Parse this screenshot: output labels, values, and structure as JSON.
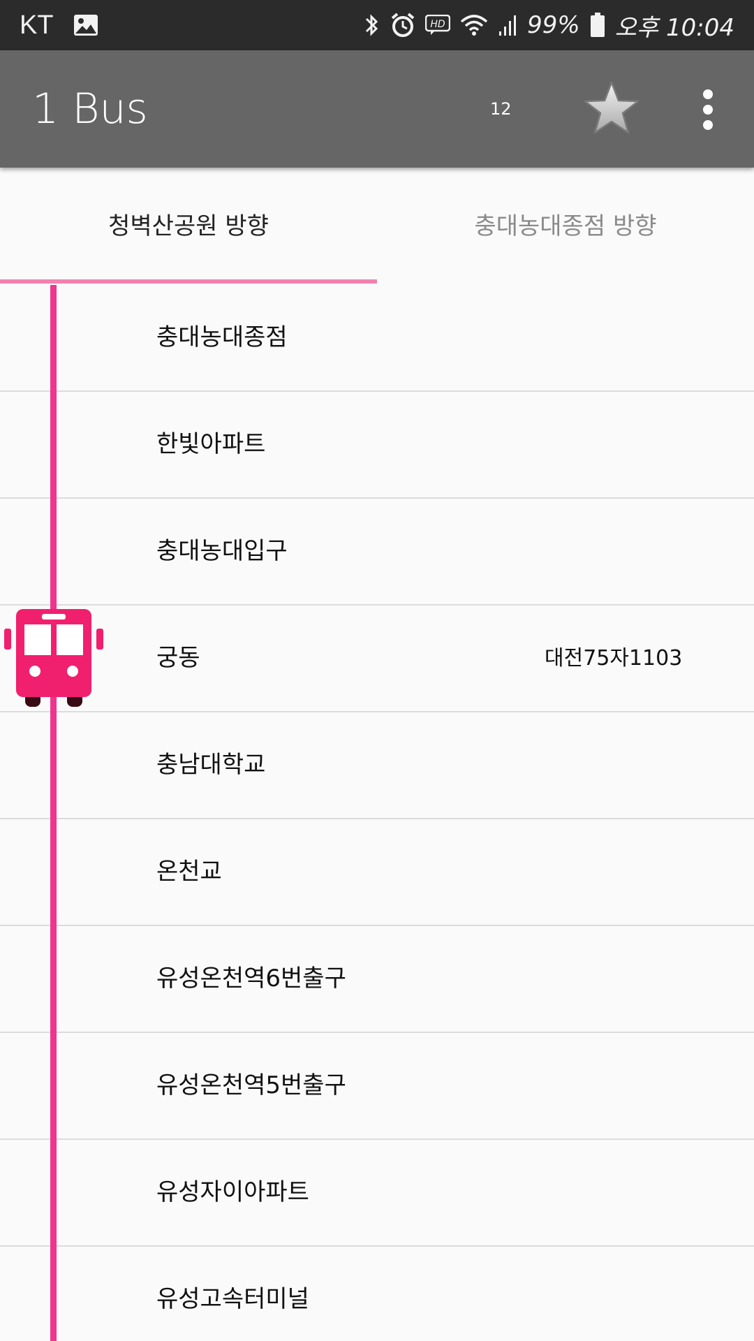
{
  "status_bar": {
    "carrier": "KT",
    "battery": "99%",
    "time": "오후 10:04"
  },
  "app_bar": {
    "title": "1 Bus",
    "secondary": "12"
  },
  "tabs": [
    {
      "label": "청벽산공원 방향",
      "selected": true
    },
    {
      "label": "충대농대종점 방향",
      "selected": false
    }
  ],
  "stops": [
    {
      "name": "충대농대종점",
      "bus": ""
    },
    {
      "name": "한빛아파트",
      "bus": ""
    },
    {
      "name": "충대농대입구",
      "bus": ""
    },
    {
      "name": "궁동",
      "bus": "대전75자1103"
    },
    {
      "name": "충남대학교",
      "bus": ""
    },
    {
      "name": "온천교",
      "bus": ""
    },
    {
      "name": "유성온천역6번출구",
      "bus": ""
    },
    {
      "name": "유성온천역5번출구",
      "bus": ""
    },
    {
      "name": "유성자이아파트",
      "bus": ""
    },
    {
      "name": "유성고속터미널",
      "bus": ""
    }
  ],
  "colors": {
    "accent": "#f0358f",
    "bus_icon": "#f0206e",
    "app_bar": "#666666"
  },
  "icons": {
    "picture": "image-icon",
    "bluetooth": "bluetooth-icon",
    "alarm": "alarm-icon",
    "hd": "hd-voice-icon",
    "wifi": "wifi-icon",
    "signal": "signal-icon",
    "battery": "battery-icon",
    "favorite": "star-icon",
    "more": "more-vert-icon",
    "bus": "bus-icon"
  }
}
